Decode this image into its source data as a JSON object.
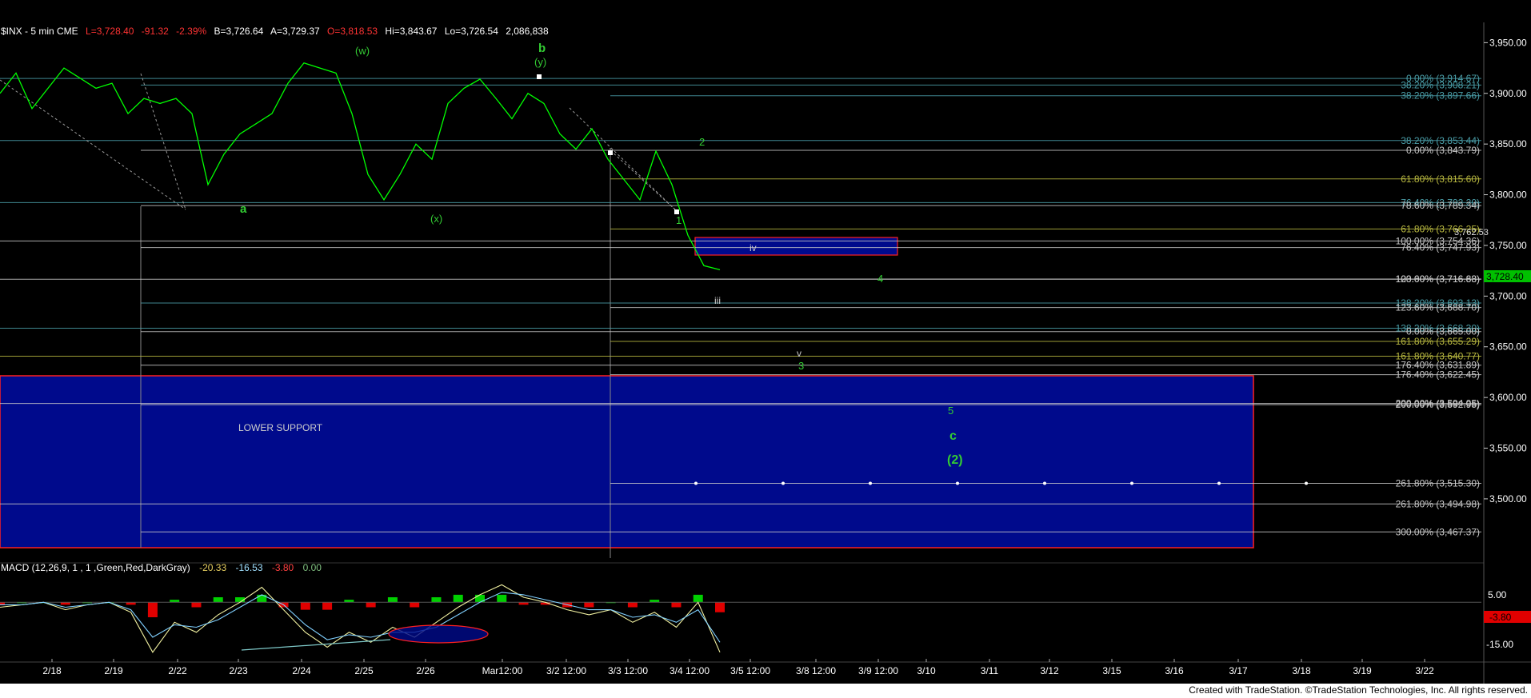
{
  "header": {
    "symbol": "$INX - 5 min CME",
    "last": "L=3,728.40",
    "change": "-91.32",
    "change_pct": "-2.39%",
    "bid": "B=3,726.64",
    "ask": "A=3,729.37",
    "open": "O=3,818.53",
    "high": "Hi=3,843.67",
    "low": "Lo=3,726.54",
    "volume": "2,086,838"
  },
  "colors": {
    "background": "#000000",
    "price_line": "#00ff00",
    "fib_white": "#c8c8c8",
    "fib_teal": "#4a9ea8",
    "fib_olive": "#b9b940",
    "support_fill": "#000a8c",
    "support_border": "#ff2020",
    "wave_label": "#33cc33",
    "last_price_box": "#00c000",
    "macd_box": "#e00000"
  },
  "price_axis_ticks": [
    "3,950.00",
    "3,900.00",
    "3,850.00",
    "3,800.00",
    "3,750.00",
    "3,700.00",
    "3,650.00",
    "3,600.00",
    "3,550.00",
    "3,500.00"
  ],
  "last_price_label": "3,728.40",
  "right_small_label": "3,762.53",
  "date_axis_ticks": [
    "2/18",
    "2/19",
    "2/22",
    "2/23",
    "2/24",
    "2/25",
    "2/26",
    "Mar12:00",
    "3/2 12:00",
    "3/3 12:00",
    "3/4 12:00",
    "3/5 12:00",
    "3/8 12:00",
    "3/9 12:00",
    "3/10",
    "3/11",
    "3/12",
    "3/15",
    "3/16",
    "3/17",
    "3/18",
    "3/19",
    "3/22"
  ],
  "fib_labels": [
    {
      "text": "0.00% (3,914.67)",
      "value": 3914.67,
      "color": "teal"
    },
    {
      "text": "38.20% (3,908.21)",
      "value": 3908.21,
      "color": "teal"
    },
    {
      "text": "38.20% (3,897.66)",
      "value": 3897.66,
      "color": "teal"
    },
    {
      "text": "38.20% (3,853.44)",
      "value": 3853.44,
      "color": "teal"
    },
    {
      "text": "0.00% (3,843.79)",
      "value": 3843.79,
      "color": "white"
    },
    {
      "text": "61.80% (3,815.60)",
      "value": 3815.6,
      "color": "olive"
    },
    {
      "text": "76.40% (3,792.20)",
      "value": 3792.2,
      "color": "teal"
    },
    {
      "text": "78.60% (3,789.34)",
      "value": 3789.34,
      "color": "white"
    },
    {
      "text": "61.80% (3,766.25)",
      "value": 3766.25,
      "color": "olive"
    },
    {
      "text": "100.00% (3,754.36)",
      "value": 3754.36,
      "color": "white"
    },
    {
      "text": "76.40% (3,747.93)",
      "value": 3747.93,
      "color": "white"
    },
    {
      "text": "123.60% (3,716.83)",
      "value": 3716.83,
      "color": "white"
    },
    {
      "text": "100.00% (3,716.68)",
      "value": 3716.68,
      "color": "white"
    },
    {
      "text": "138.20% (3,693.13)",
      "value": 3693.13,
      "color": "teal"
    },
    {
      "text": "123.60% (3,688.70)",
      "value": 3688.7,
      "color": "white"
    },
    {
      "text": "138.20% (3,668.30)",
      "value": 3668.3,
      "color": "teal"
    },
    {
      "text": "0.00% (3,665.00)",
      "value": 3665.0,
      "color": "white"
    },
    {
      "text": "161.80% (3,655.29)",
      "value": 3655.29,
      "color": "olive"
    },
    {
      "text": "161.80% (3,640.77)",
      "value": 3640.77,
      "color": "olive"
    },
    {
      "text": "176.40% (3,631.89)",
      "value": 3631.89,
      "color": "white"
    },
    {
      "text": "176.40% (3,622.45)",
      "value": 3622.45,
      "color": "white"
    },
    {
      "text": "200.00% (3,594.05)",
      "value": 3594.05,
      "color": "white"
    },
    {
      "text": "200.00% (3,592.95)",
      "value": 3592.95,
      "color": "white"
    },
    {
      "text": "261.80% (3,515.30)",
      "value": 3515.3,
      "color": "white"
    },
    {
      "text": "261.80% (3,494.98)",
      "value": 3494.98,
      "color": "white"
    },
    {
      "text": "300.00% (3,467.37)",
      "value": 3467.37,
      "color": "white"
    }
  ],
  "wave_labels": {
    "w": "(w)",
    "b_top": "b",
    "y": "(y)",
    "a": "a",
    "x": "(x)",
    "one": "1",
    "two": "2",
    "iii": "iii",
    "iv": "iv",
    "four": "4",
    "v": "v",
    "three": "3",
    "five": "5",
    "c": "c",
    "paren2": "(2)"
  },
  "lower_support_label": "LOWER SUPPORT",
  "macd": {
    "title": "MACD (12,26,9, 1 , 1 ,Green,Red,DarkGray)",
    "v1": "-20.33",
    "v2": "-16.53",
    "v3": "-3.80",
    "v4": "0.00",
    "axis_ticks": [
      "5.00",
      "-15.00"
    ],
    "current_box": "-3.80"
  },
  "footer": "Created with TradeStation. ©TradeStation Technologies, Inc. All rights reserved.",
  "chart_data": {
    "type": "line",
    "title": "$INX - 5 min CME",
    "ylim": [
      3440,
      3970
    ],
    "price_series": [
      [
        "2/17",
        3900
      ],
      [
        "2/17",
        3920
      ],
      [
        "2/18",
        3885
      ],
      [
        "2/18",
        3905
      ],
      [
        "2/18",
        3925
      ],
      [
        "2/19",
        3915
      ],
      [
        "2/19",
        3905
      ],
      [
        "2/19",
        3910
      ],
      [
        "2/22",
        3880
      ],
      [
        "2/22",
        3895
      ],
      [
        "2/22",
        3890
      ],
      [
        "2/22",
        3895
      ],
      [
        "2/22",
        3880
      ],
      [
        "2/23",
        3810
      ],
      [
        "2/23",
        3840
      ],
      [
        "2/23",
        3860
      ],
      [
        "2/24",
        3870
      ],
      [
        "2/24",
        3880
      ],
      [
        "2/24",
        3910
      ],
      [
        "2/25",
        3930
      ],
      [
        "2/25",
        3925
      ],
      [
        "2/25",
        3920
      ],
      [
        "2/25",
        3880
      ],
      [
        "2/26",
        3820
      ],
      [
        "2/26",
        3795
      ],
      [
        "2/26",
        3820
      ],
      [
        "2/26",
        3850
      ],
      [
        "Mar",
        3835
      ],
      [
        "Mar",
        3890
      ],
      [
        "Mar",
        3905
      ],
      [
        "3/2",
        3914
      ],
      [
        "3/2",
        3895
      ],
      [
        "3/2",
        3875
      ],
      [
        "3/2",
        3900
      ],
      [
        "3/3",
        3890
      ],
      [
        "3/3",
        3860
      ],
      [
        "3/3",
        3845
      ],
      [
        "3/3",
        3865
      ],
      [
        "3/3",
        3835
      ],
      [
        "3/4",
        3815
      ],
      [
        "3/4",
        3795
      ],
      [
        "3/4",
        3843
      ],
      [
        "3/4",
        3810
      ],
      [
        "3/4",
        3760
      ],
      [
        "3/4",
        3730
      ],
      [
        "3/4",
        3726
      ]
    ],
    "macd_series": {
      "macd": [
        -2,
        -1,
        0,
        -3,
        -1,
        0,
        -4,
        -20,
        -8,
        -12,
        -5,
        0,
        6,
        -3,
        -12,
        -18,
        -12,
        -16,
        -10,
        -14,
        -8,
        -2,
        3,
        7,
        2,
        0,
        -3,
        -5,
        -3,
        -8,
        -4,
        -10,
        0,
        -20
      ],
      "signal": [
        -1,
        -1,
        0,
        -2,
        -1,
        0,
        -3,
        -14,
        -9,
        -10,
        -7,
        -2,
        3,
        -1,
        -9,
        -15,
        -13,
        -14,
        -12,
        -12,
        -10,
        -5,
        0,
        4,
        3,
        1,
        -1,
        -3,
        -3,
        -6,
        -5,
        -8,
        -3,
        -16
      ]
    }
  }
}
